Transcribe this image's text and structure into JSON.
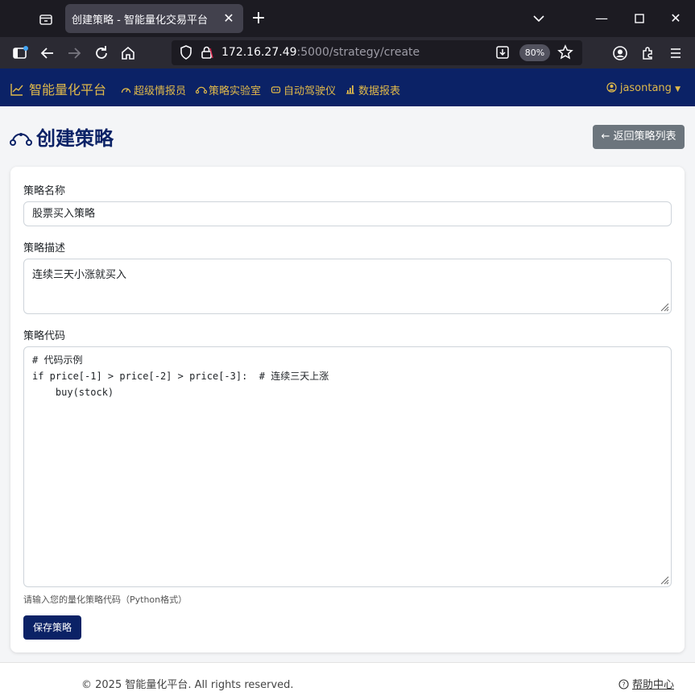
{
  "browser": {
    "tab_title": "创建策略 - 智能量化交易平台",
    "url_host": "172.16.27.49",
    "url_path": ":5000/strategy/create",
    "zoom": "80%"
  },
  "app": {
    "brand": "智能量化平台",
    "nav": [
      "超级情报员",
      "策略实验室",
      "自动驾驶仪",
      "数据报表"
    ],
    "user": "jasontang"
  },
  "page": {
    "title": "创建策略",
    "back_button": "← 返回策略列表"
  },
  "form": {
    "name_label": "策略名称",
    "name_value": "股票买入策略",
    "desc_label": "策略描述",
    "desc_value": "连续三天小涨就买入",
    "code_label": "策略代码",
    "code_value": "# 代码示例\nif price[-1] > price[-2] > price[-3]:  # 连续三天上涨\n    buy(stock)",
    "code_help": "请输入您的量化策略代码（Python格式）",
    "save_button": "保存策略"
  },
  "footer": {
    "copyright": "© 2025 智能量化平台. All rights reserved.",
    "help": "帮助中心"
  },
  "colors": {
    "navbar": "#0b2266",
    "accent_gold": "#e0b94a",
    "primary": "#0b2266",
    "secondary": "#6c757d"
  }
}
